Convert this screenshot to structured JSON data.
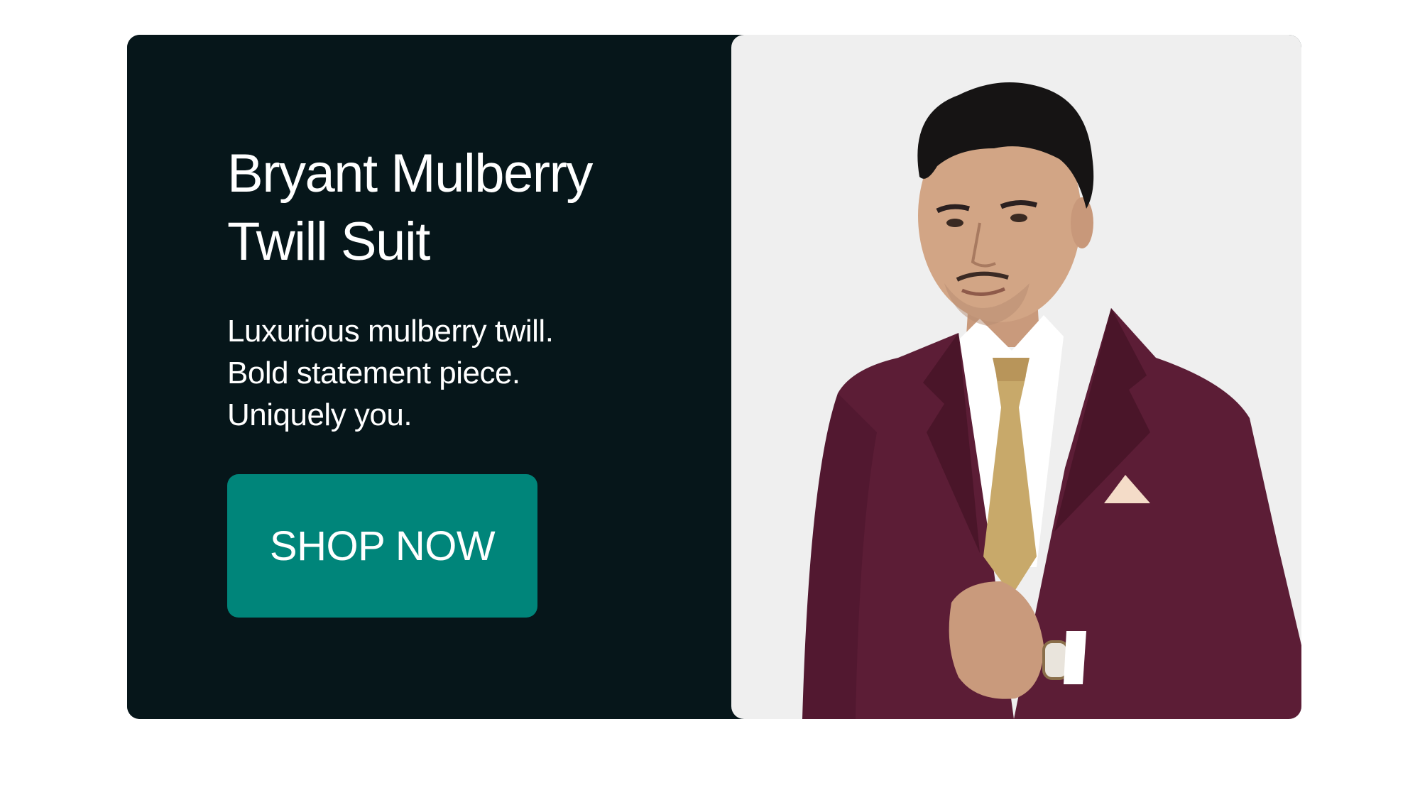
{
  "hero": {
    "title_lines": [
      "Bryant Mulberry",
      "Twill Suit"
    ],
    "description_lines": [
      "Luxurious mulberry twill.",
      "Bold statement piece.",
      "Uniquely you."
    ],
    "cta_label": "SHOP NOW"
  },
  "image": {
    "subject": "model-in-mulberry-suit",
    "background_color": "#efefef",
    "suit_color": "#5c1d36",
    "tie_color": "#c8a96a"
  },
  "colors": {
    "panel_background": "#06161a",
    "accent": "#00857a",
    "text": "#ffffff"
  }
}
